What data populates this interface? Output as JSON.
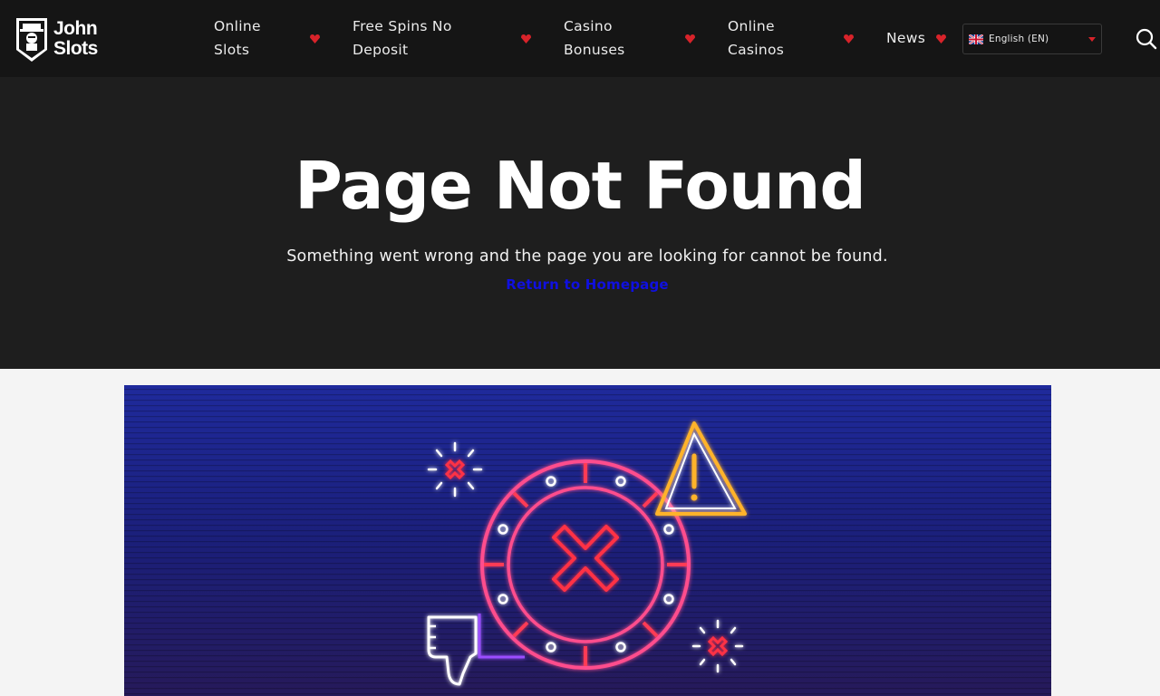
{
  "brand": {
    "name_line1": "John",
    "name_line2": "Slots"
  },
  "nav": {
    "items": [
      {
        "label_line1": "Online",
        "label_line2": "Slots"
      },
      {
        "label_line1": "Free Spins No",
        "label_line2": "Deposit"
      },
      {
        "label_line1": "Casino",
        "label_line2": "Bonuses"
      },
      {
        "label_line1": "Online",
        "label_line2": "Casinos"
      },
      {
        "label_line1": "News",
        "label_line2": ""
      }
    ],
    "accent_color": "#d8232a"
  },
  "language": {
    "selected": "English (EN)",
    "flag_icon": "uk-flag-icon"
  },
  "search": {
    "icon": "search-icon"
  },
  "hero": {
    "title": "Page Not Found",
    "subtitle": "Something went wrong and the page you are looking for cannot be found.",
    "link": "Return to Homepage"
  },
  "illustration": {
    "icons": [
      "casino-chip-icon",
      "x-mark-icon",
      "warning-triangle-icon",
      "thumbs-down-icon",
      "sparkle-x-icon"
    ]
  }
}
